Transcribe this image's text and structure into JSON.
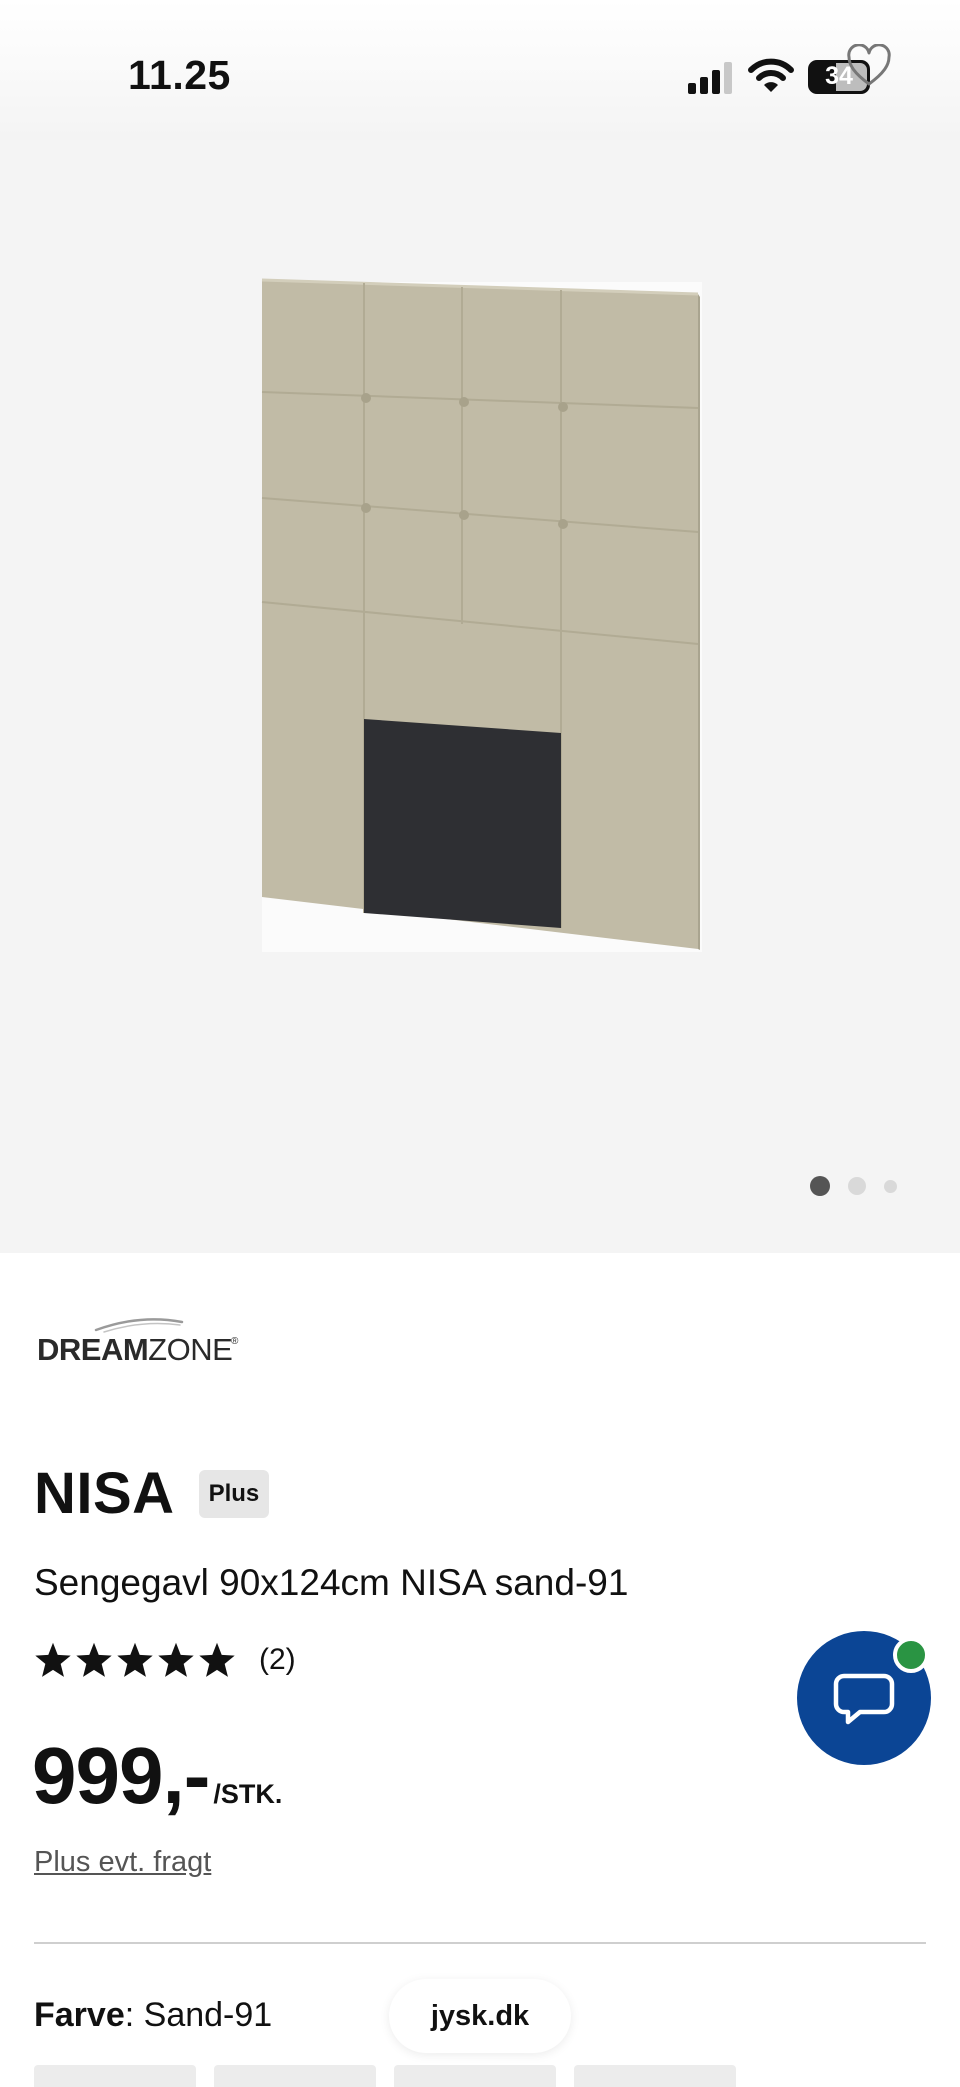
{
  "status_bar": {
    "time": "11.25",
    "battery_level": "34"
  },
  "gallery": {
    "image_description": "Headboard",
    "slide_count": 3,
    "active_slide": 1
  },
  "brand": {
    "logo_text_bold": "DREAM",
    "logo_text_light": "ZONE",
    "logo_mark": "®"
  },
  "product": {
    "name": "NISA",
    "badge": "Plus",
    "subtitle": "Sengegavl 90x124cm NISA sand-91",
    "rating_stars": 5,
    "review_count": "(2)",
    "price": "999,-",
    "unit": "/STK.",
    "shipping_link": "Plus evt. fragt"
  },
  "variant": {
    "label": "Farve",
    "separator": ": ",
    "value": "Sand-91"
  },
  "browser": {
    "domain": "jysk.dk"
  },
  "icons": {
    "signal": "signal-icon",
    "wifi": "wifi-icon",
    "battery": "battery-icon",
    "wishlist": "heart-icon",
    "chat": "chat-bubble-icon",
    "star": "star-icon"
  },
  "colors": {
    "chat_button": "#0b4595",
    "online_indicator": "#2a9443",
    "hero_background": "#f4f4f4",
    "badge_background": "#e6e6e6",
    "headboard_fabric": "#c1bba6"
  }
}
